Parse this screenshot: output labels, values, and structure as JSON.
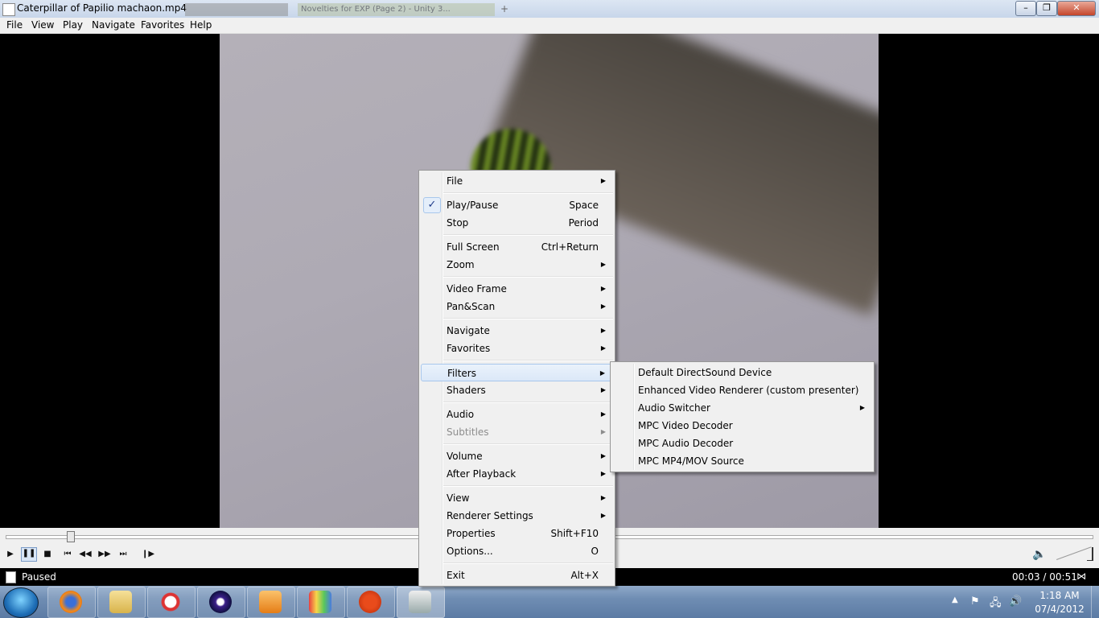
{
  "window": {
    "title": "Caterpillar of Papilio machaon.mp4",
    "bg_tab_label": "Novelties for EXP (Page 2) - Unity 3...",
    "new_tab_symbol": "+",
    "min_symbol": "–",
    "max_symbol": "❐",
    "close_symbol": "✕"
  },
  "menubar": [
    "File",
    "View",
    "Play",
    "Navigate",
    "Favorites",
    "Help"
  ],
  "context_menu": {
    "items": [
      {
        "label": "File",
        "submenu": true
      },
      {
        "label": "Play/Pause",
        "shortcut": "Space",
        "checked": true
      },
      {
        "label": "Stop",
        "shortcut": "Period"
      },
      {
        "label": "Full Screen",
        "shortcut": "Ctrl+Return"
      },
      {
        "label": "Zoom",
        "submenu": true
      },
      {
        "label": "Video Frame",
        "submenu": true
      },
      {
        "label": "Pan&Scan",
        "submenu": true
      },
      {
        "label": "Navigate",
        "submenu": true
      },
      {
        "label": "Favorites",
        "submenu": true
      },
      {
        "label": "Filters",
        "submenu": true,
        "highlighted": true
      },
      {
        "label": "Shaders",
        "submenu": true
      },
      {
        "label": "Audio",
        "submenu": true
      },
      {
        "label": "Subtitles",
        "submenu": true,
        "disabled": true
      },
      {
        "label": "Volume",
        "submenu": true
      },
      {
        "label": "After Playback",
        "submenu": true
      },
      {
        "label": "View",
        "submenu": true
      },
      {
        "label": "Renderer Settings",
        "submenu": true
      },
      {
        "label": "Properties",
        "shortcut": "Shift+F10"
      },
      {
        "label": "Options...",
        "shortcut": "O"
      },
      {
        "label": "Exit",
        "shortcut": "Alt+X"
      }
    ],
    "check_symbol": "✓",
    "arrow_symbol": "▶"
  },
  "filters_submenu": {
    "items": [
      {
        "label": "Default DirectSound Device"
      },
      {
        "label": "Enhanced Video Renderer (custom presenter)"
      },
      {
        "label": "Audio Switcher",
        "submenu": true
      },
      {
        "label": "MPC Video Decoder"
      },
      {
        "label": "MPC Audio Decoder"
      },
      {
        "label": "MPC MP4/MOV Source"
      }
    ]
  },
  "controls": {
    "seek_progress": 0.059,
    "play_symbol": "▶",
    "pause_symbol": "❚❚",
    "stop_symbol": "■",
    "prev_symbol": "⏮",
    "rewind_symbol": "◀◀",
    "forward_symbol": "▶▶",
    "next_symbol": "⏭",
    "frame_step_symbol": "❙▶",
    "volume_symbol": "🔈"
  },
  "status": {
    "state": "Paused",
    "time": "00:03 / 00:51",
    "stats_symbol": "⋈"
  },
  "taskbar": {
    "apps": [
      "firefox",
      "explorer",
      "snipping-tool",
      "media-center",
      "media-player",
      "paint",
      "ccleaner",
      "mpc-hc"
    ],
    "tray_arrow": "▲",
    "tray_icons": [
      "⚑",
      "🖧",
      "🔊"
    ],
    "clock_time": "1:18 AM",
    "clock_date": "07/4/2012"
  }
}
